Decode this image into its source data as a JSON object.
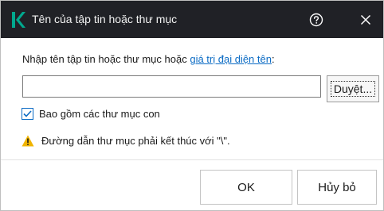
{
  "window": {
    "title": "Tên của tập tin hoặc thư mục",
    "logo_icon": "kaspersky-k-logo",
    "logo_color": "#00a88e",
    "help_icon": "help-circle-icon",
    "close_icon": "close-icon"
  },
  "form": {
    "prompt_text": "Nhập tên tập tin hoặc thư mục hoặc ",
    "prompt_link": "giá trị đại diện tên",
    "prompt_suffix": ":",
    "input_value": "",
    "browse_label": "Duyệt...",
    "subfolders_label": "Bao gồm các thư mục con",
    "subfolders_checked": true,
    "warning_icon": "warning-triangle-icon",
    "warning_color": "#f0b400",
    "warning_text": "Đường dẫn thư mục phải kết thúc với \"\\\"."
  },
  "footer": {
    "ok_label": "OK",
    "cancel_label": "Hủy bỏ"
  }
}
